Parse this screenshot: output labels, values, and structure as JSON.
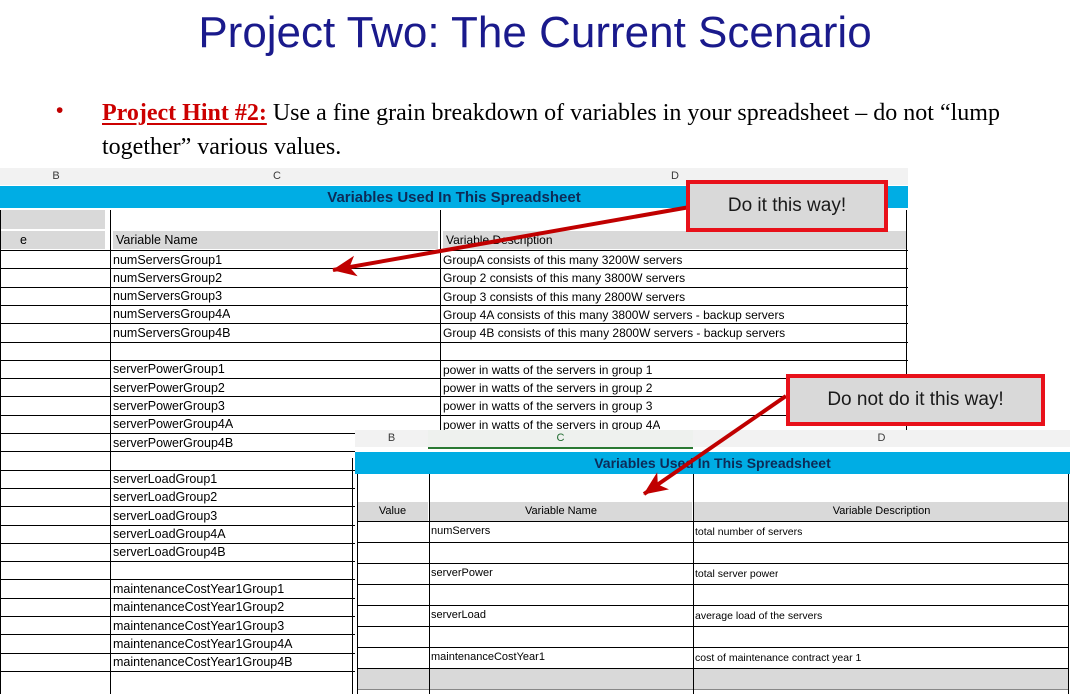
{
  "slide": {
    "title": "Project Two: The Current Scenario",
    "bullet": {
      "marker": "•",
      "hint_label": "Project Hint #2:",
      "body": " Use a fine grain breakdown of variables in your spreadsheet – do not “lump together” various values."
    }
  },
  "callouts": {
    "good": "Do it this way!",
    "bad": "Do not do it this way!"
  },
  "colors": {
    "title": "#1a1a8c",
    "hint_red": "#cc0000",
    "banner_blue": "#00ade4",
    "banner_text": "#0d2b57",
    "header_gray": "#d9d9d9",
    "callout_border": "#e8111a",
    "arrow_red": "#c00000",
    "selected_column_green": "#2a7a33"
  },
  "sheet_good": {
    "column_letters": [
      "B",
      "C",
      "D"
    ],
    "banner": "Variables Used In This Spreadsheet",
    "headers": {
      "value": "e",
      "name": "Variable Name",
      "description": "Variable Description"
    },
    "rows": [
      {
        "name": "numServersGroup1",
        "description": "GroupA consists of this many 3200W servers"
      },
      {
        "name": "numServersGroup2",
        "description": "Group 2 consists of this many 3800W servers"
      },
      {
        "name": "numServersGroup3",
        "description": "Group 3 consists of this many 2800W servers"
      },
      {
        "name": "numServersGroup4A",
        "description": "Group 4A consists of this many 3800W servers - backup servers"
      },
      {
        "name": "numServersGroup4B",
        "description": "Group 4B consists of this many 2800W servers - backup servers"
      },
      {
        "name": "",
        "description": ""
      },
      {
        "name": "serverPowerGroup1",
        "description": "power in watts of the servers in group 1"
      },
      {
        "name": "serverPowerGroup2",
        "description": "power in watts of the servers in group 2"
      },
      {
        "name": "serverPowerGroup3",
        "description": "power in watts of the servers in group 3"
      },
      {
        "name": "serverPowerGroup4A",
        "description": "power in watts of the servers in group 4A"
      },
      {
        "name": "serverPowerGroup4B",
        "description": ""
      },
      {
        "name": "",
        "description": ""
      },
      {
        "name": "serverLoadGroup1",
        "description": ""
      },
      {
        "name": "serverLoadGroup2",
        "description": ""
      },
      {
        "name": "serverLoadGroup3",
        "description": ""
      },
      {
        "name": "serverLoadGroup4A",
        "description": ""
      },
      {
        "name": "serverLoadGroup4B",
        "description": ""
      },
      {
        "name": "",
        "description": ""
      },
      {
        "name": "maintenanceCostYear1Group1",
        "description": ""
      },
      {
        "name": "maintenanceCostYear1Group2",
        "description": ""
      },
      {
        "name": "maintenanceCostYear1Group3",
        "description": ""
      },
      {
        "name": "maintenanceCostYear1Group4A",
        "description": ""
      },
      {
        "name": "maintenanceCostYear1Group4B",
        "description": ""
      }
    ]
  },
  "sheet_bad": {
    "column_letters": [
      "B",
      "C",
      "D"
    ],
    "selected_column": "C",
    "banner": "Variables Used In This Spreadsheet",
    "headers": {
      "value": "Value",
      "name": "Variable Name",
      "description": "Variable Description"
    },
    "rows": [
      {
        "name": "numServers",
        "description": "total number of servers"
      },
      {
        "name": "",
        "description": ""
      },
      {
        "name": "serverPower",
        "description": "total server power"
      },
      {
        "name": "",
        "description": ""
      },
      {
        "name": "serverLoad",
        "description": "average load of the servers"
      },
      {
        "name": "",
        "description": ""
      },
      {
        "name": "maintenanceCostYear1",
        "description": "cost of maintenance contract year 1"
      }
    ]
  }
}
